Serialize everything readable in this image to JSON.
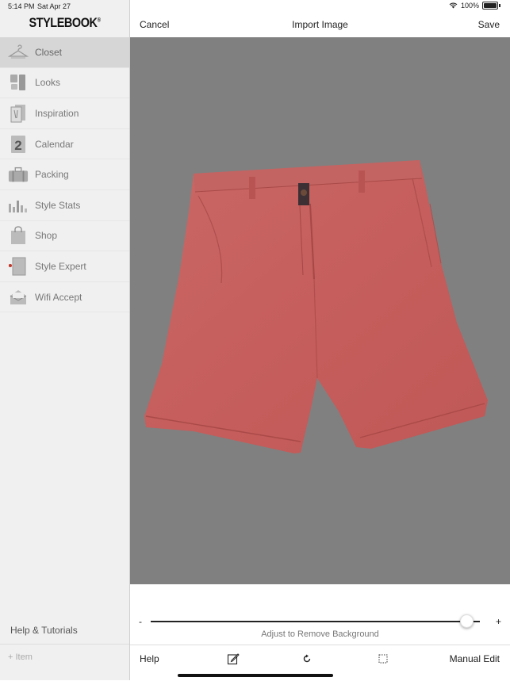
{
  "status_bar": {
    "time": "5:14 PM",
    "date": "Sat Apr 27",
    "battery": "100%"
  },
  "sidebar": {
    "logo": "STYLEBOOK",
    "logo_mark": "®",
    "items": [
      {
        "label": "Closet",
        "icon": "hanger-icon",
        "active": true
      },
      {
        "label": "Looks",
        "icon": "looks-icon",
        "active": false
      },
      {
        "label": "Inspiration",
        "icon": "inspiration-icon",
        "active": false
      },
      {
        "label": "Calendar",
        "icon": "calendar-icon",
        "active": false
      },
      {
        "label": "Packing",
        "icon": "suitcase-icon",
        "active": false
      },
      {
        "label": "Style Stats",
        "icon": "bar-chart-icon",
        "active": false
      },
      {
        "label": "Shop",
        "icon": "shopping-bag-icon",
        "active": false
      },
      {
        "label": "Style Expert",
        "icon": "book-icon",
        "active": false
      },
      {
        "label": "Wifi Accept",
        "icon": "envelope-icon",
        "active": false
      }
    ],
    "calendar_day": "2",
    "help": "Help & Tutorials",
    "add_item": "+ Item"
  },
  "topbar": {
    "cancel": "Cancel",
    "title": "Import Image",
    "save": "Save"
  },
  "canvas": {
    "background": "#808080",
    "subject": "red shorts",
    "subject_color": "#c9605e"
  },
  "slider": {
    "min_label": "-",
    "max_label": "+",
    "value": 0.96,
    "caption": "Adjust to Remove Background"
  },
  "bottombar": {
    "help": "Help",
    "tools": [
      "edit-icon",
      "rotate-icon",
      "crop-selection-icon"
    ],
    "manual_edit": "Manual Edit"
  }
}
